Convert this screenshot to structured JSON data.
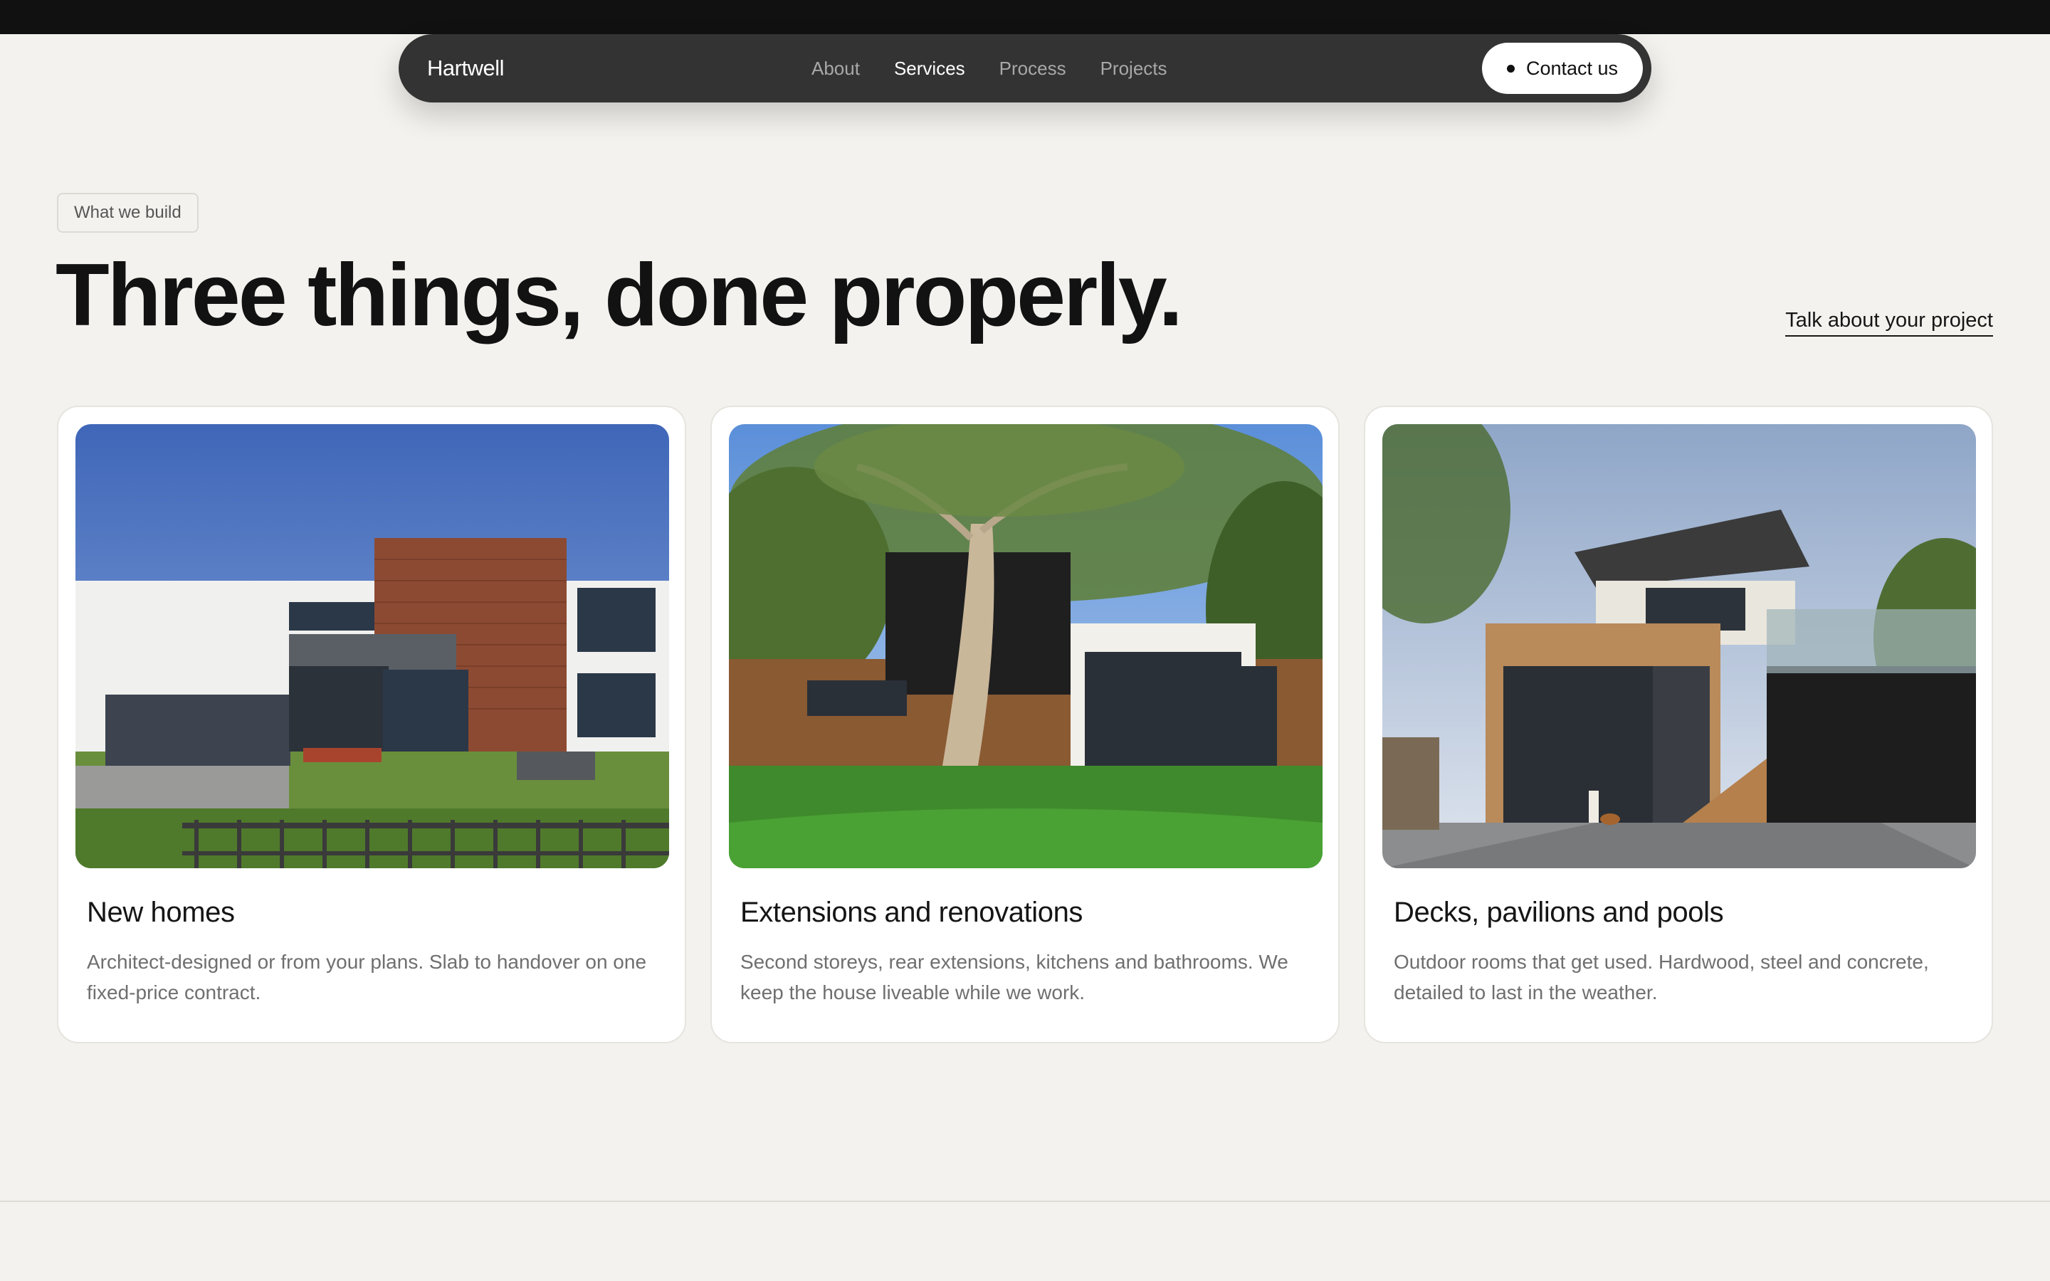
{
  "header": {
    "brand": "Hartwell",
    "nav": [
      {
        "label": "About",
        "active": false
      },
      {
        "label": "Services",
        "active": true
      },
      {
        "label": "Process",
        "active": false
      },
      {
        "label": "Projects",
        "active": false
      }
    ],
    "contact_label": "Contact us"
  },
  "section": {
    "tag": "What we build",
    "headline": "Three things, done properly.",
    "cta": "Talk about your project"
  },
  "cards": [
    {
      "title": "New homes",
      "description": "Architect-designed or from your plans. Slab to handover on one fixed-price contract.",
      "image": "modern-two-storey-house-photo"
    },
    {
      "title": "Extensions and renovations",
      "description": "Second storeys, rear extensions, kitchens and bathrooms. We keep the house liveable while we work.",
      "image": "house-extension-with-gum-tree-photo"
    },
    {
      "title": "Decks, pavilions and pools",
      "description": "Outdoor rooms that get used. Hardwood, steel and concrete, detailed to last in the weather.",
      "image": "timber-clad-house-with-courtyard-photo"
    }
  ],
  "colors": {
    "background": "#f3f2ee",
    "nav_bg": "#333333",
    "topbar": "#111111",
    "card_bg": "#ffffff"
  }
}
